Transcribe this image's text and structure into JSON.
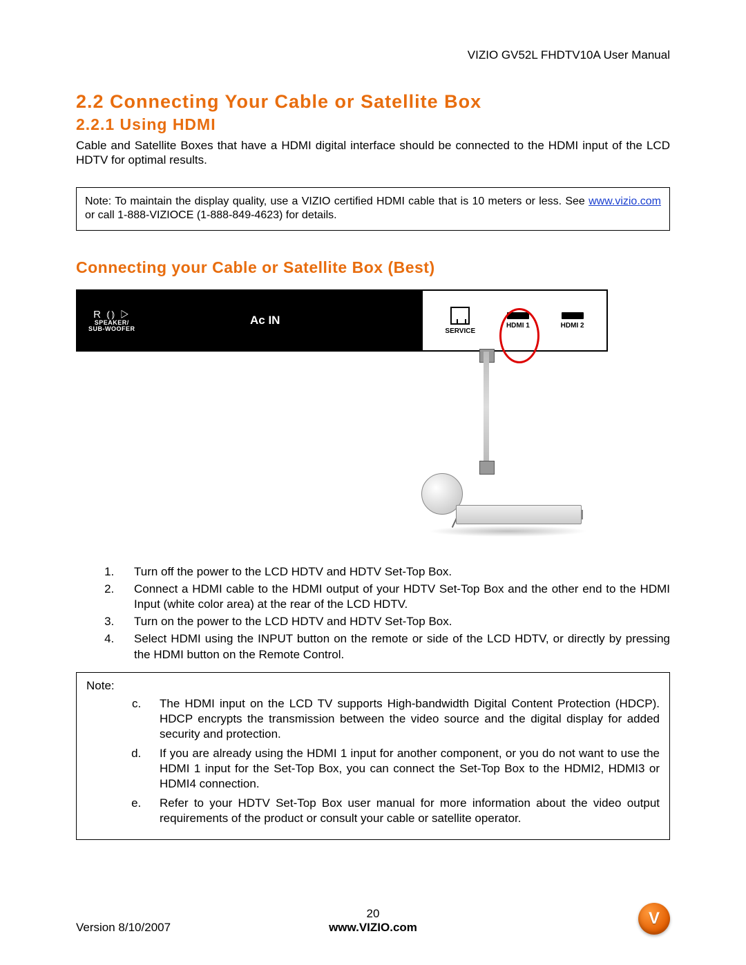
{
  "header": {
    "doc_title": "VIZIO GV52L FHDTV10A User Manual"
  },
  "headings": {
    "h1": "2.2  Connecting Your Cable or Satellite Box",
    "h2": "2.2.1 Using HDMI",
    "h3": "Connecting your Cable or Satellite Box (Best)"
  },
  "intro": "Cable and Satellite Boxes that have a HDMI digital interface should be connected to the HDMI input of the LCD HDTV for optimal results.",
  "note1": {
    "pre": "Note: To maintain the display quality, use a VIZIO certified HDMI cable that is 10 meters or less.  See ",
    "link": "www.vizio.com",
    "post": " or call 1-888-VIZIOCE (1-888-849-4623) for details."
  },
  "diagram": {
    "speaker_icons": "R ⦅⦆ ▷",
    "speaker_label_1": "SPEAKER/",
    "speaker_label_2": "SUB-WOOFER",
    "ac_in": "Ac  IN",
    "ports": {
      "service": "SERVICE",
      "hdmi1": "HDMI 1",
      "hdmi2": "HDMI 2"
    }
  },
  "steps": [
    "Turn off the power to the LCD HDTV and HDTV Set-Top Box.",
    "Connect a HDMI cable to the HDMI output of your HDTV Set-Top Box and the other end to the HDMI Input (white color area) at the rear of the LCD HDTV.",
    "Turn on the power to the LCD HDTV and HDTV Set-Top Box.",
    "Select HDMI using the INPUT button on the remote or side of the LCD HDTV, or directly by pressing the HDMI button on the Remote Control."
  ],
  "note2": {
    "title": "Note:",
    "items": [
      "The HDMI input on the LCD TV supports High-bandwidth Digital Content Protection (HDCP).  HDCP encrypts the transmission between the video source and the digital display for added security and protection.",
      "If you are already using the HDMI 1 input for another component, or you do not want to use the HDMI 1 input for the Set-Top Box, you can connect the Set-Top Box to the HDMI2, HDMI3 or HDMI4 connection.",
      "Refer to your HDTV Set-Top Box user manual for more information about the video output requirements of the product or consult your cable or satellite operator."
    ]
  },
  "footer": {
    "version": "Version 8/10/2007",
    "page": "20",
    "url": "www.VIZIO.com",
    "logo_letter": "V"
  }
}
